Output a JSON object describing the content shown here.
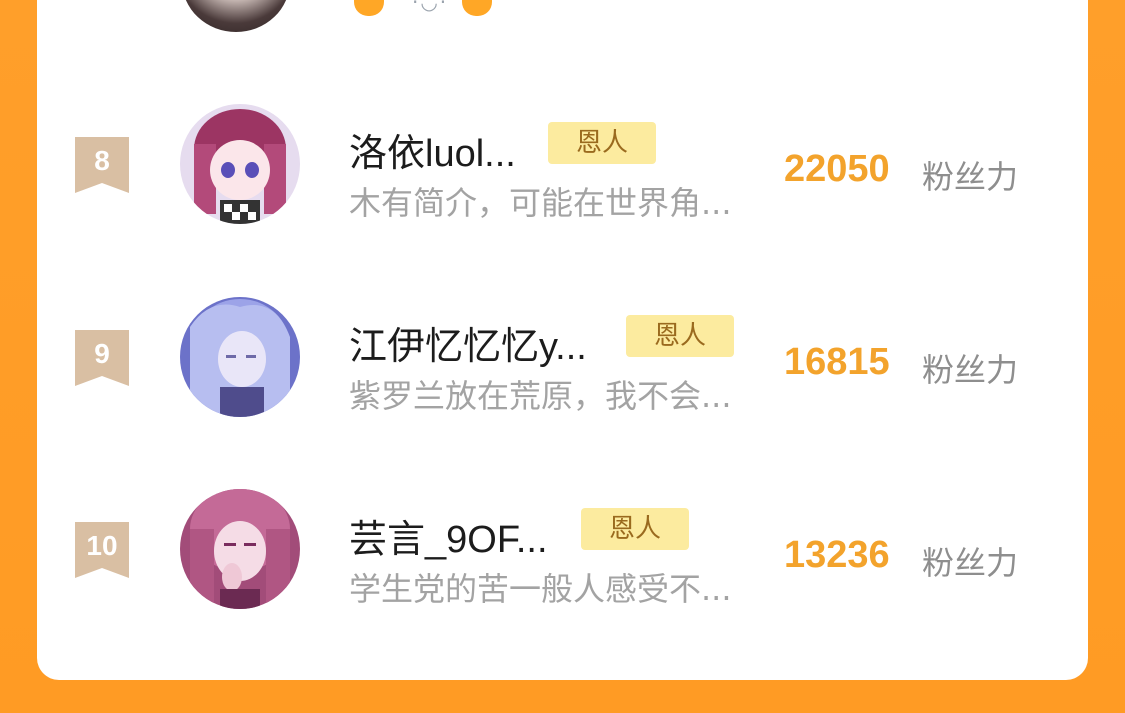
{
  "partial_row": {
    "emoji_face": "·◡·"
  },
  "rows": [
    {
      "rank": "8",
      "name": "洛依luol...",
      "tag": "恩人",
      "desc": "木有简介，可能在世界角...",
      "score": "22050",
      "unit": "粉丝力",
      "avatar_colors": [
        "#E9D3E3",
        "#8B2C5A",
        "#E7A9C6"
      ]
    },
    {
      "rank": "9",
      "name": "江伊忆忆忆y...",
      "tag": "恩人",
      "desc": "紫罗兰放在荒原，我不会...",
      "score": "16815",
      "unit": "粉丝力",
      "avatar_colors": [
        "#9FA7E6",
        "#5A5DB8",
        "#E8E6F5"
      ]
    },
    {
      "rank": "10",
      "name": "芸言_9OF...",
      "tag": "恩人",
      "desc": "学生党的苦一般人感受不...",
      "score": "13236",
      "unit": "粉丝力",
      "avatar_colors": [
        "#C77BA0",
        "#7A2C5E",
        "#F2D7E2"
      ]
    }
  ],
  "colors": {
    "background": "#FF9F2A",
    "card": "#FFFFFF",
    "rank_badge": "#D9BFA3",
    "score": "#F3A32C",
    "tag_bg": "#FCEB9F",
    "tag_text": "#9A6A1E"
  }
}
